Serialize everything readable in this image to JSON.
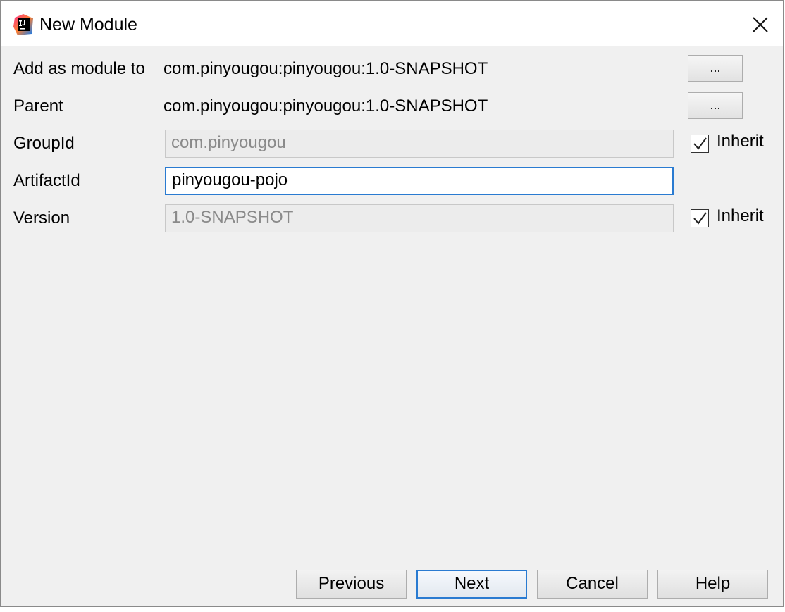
{
  "window": {
    "title": "New Module",
    "app_icon": "intellij-icon",
    "close_icon": "close-icon"
  },
  "form": {
    "add_as_module_to": {
      "label": "Add as module to",
      "value": "com.pinyougou:pinyougou:1.0-SNAPSHOT",
      "browse_label": "..."
    },
    "parent": {
      "label": "Parent",
      "value": "com.pinyougou:pinyougou:1.0-SNAPSHOT",
      "browse_label": "..."
    },
    "group_id": {
      "label": "GroupId",
      "value": "com.pinyougou",
      "enabled": false,
      "inherit_label": "Inherit",
      "inherit_checked": true
    },
    "artifact_id": {
      "label": "ArtifactId",
      "value": "pinyougou-pojo",
      "enabled": true
    },
    "version": {
      "label": "Version",
      "value": "1.0-SNAPSHOT",
      "enabled": false,
      "inherit_label": "Inherit",
      "inherit_checked": true
    }
  },
  "buttons": {
    "previous": "Previous",
    "next": "Next",
    "cancel": "Cancel",
    "help": "Help"
  },
  "colors": {
    "focus_accent": "#2a7bd1",
    "dialog_background": "#f0f0f0"
  }
}
